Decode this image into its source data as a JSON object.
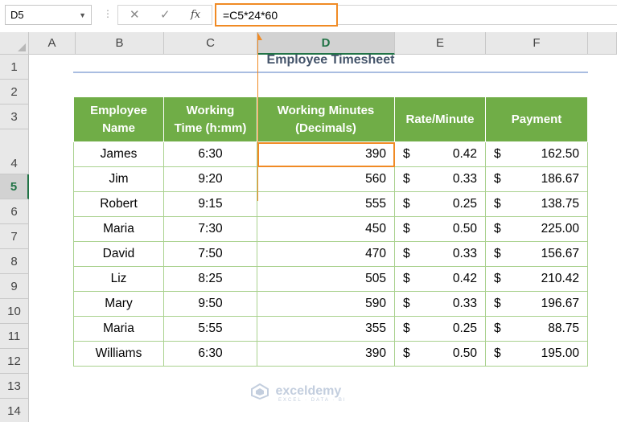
{
  "formula_bar": {
    "name_box": "D5",
    "formula": "=C5*24*60",
    "cancel_icon": "✕",
    "enter_icon": "✓",
    "fx_label": "fx"
  },
  "columns": [
    "A",
    "B",
    "C",
    "D",
    "E",
    "F"
  ],
  "rows": [
    "1",
    "2",
    "3",
    "4",
    "5",
    "6",
    "7",
    "8",
    "9",
    "10",
    "11",
    "12",
    "13",
    "14"
  ],
  "selected_cell": {
    "column": "D",
    "row": "5"
  },
  "title": "Employee Timesheet",
  "table": {
    "headers": {
      "name": [
        "Employee",
        "Name"
      ],
      "time": [
        "Working",
        "Time (h:mm)"
      ],
      "mins": [
        "Working Minutes",
        "(Decimals)"
      ],
      "rate": "Rate/Minute",
      "pay": "Payment"
    },
    "rows": [
      {
        "name": "James",
        "time": "6:30",
        "mins": "390",
        "rate": "0.42",
        "pay": "162.50"
      },
      {
        "name": "Jim",
        "time": "9:20",
        "mins": "560",
        "rate": "0.33",
        "pay": "186.67"
      },
      {
        "name": "Robert",
        "time": "9:15",
        "mins": "555",
        "rate": "0.25",
        "pay": "138.75"
      },
      {
        "name": "Maria",
        "time": "7:30",
        "mins": "450",
        "rate": "0.50",
        "pay": "225.00"
      },
      {
        "name": "David",
        "time": "7:50",
        "mins": "470",
        "rate": "0.33",
        "pay": "156.67"
      },
      {
        "name": "Liz",
        "time": "8:25",
        "mins": "505",
        "rate": "0.42",
        "pay": "210.42"
      },
      {
        "name": "Mary",
        "time": "9:50",
        "mins": "590",
        "rate": "0.33",
        "pay": "196.67"
      },
      {
        "name": "Maria",
        "time": "5:55",
        "mins": "355",
        "rate": "0.25",
        "pay": "88.75"
      },
      {
        "name": "Williams",
        "time": "6:30",
        "mins": "390",
        "rate": "0.50",
        "pay": "195.00"
      }
    ],
    "currency": "$"
  },
  "watermark": {
    "name": "exceldemy",
    "tagline": "EXCEL · DATA · BI"
  },
  "colors": {
    "header_green": "#70ad47",
    "highlight_orange": "#f08a24",
    "title_blue": "#44546a",
    "selection_green": "#217346"
  }
}
